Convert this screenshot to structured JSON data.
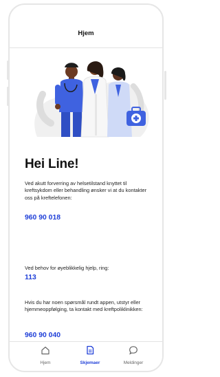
{
  "header": {
    "title": "Hjem"
  },
  "main": {
    "greeting": "Hei Line!",
    "blocks": [
      {
        "text": "Ved akutt forverring av helsetilstand knyttet til kreftsykdom eller behandling ønsker vi at du kontakter oss på kreftelefonen:",
        "phone": "960 90 018"
      },
      {
        "text": "Ved behov for øyeblikkelig hjelp, ring:",
        "phone": "113"
      },
      {
        "text": "Hvis du har noen spørsmål rundt appen, utstyr eller hjemmeoppfølging, ta kontakt med kreftpoliklinikken:",
        "phone": "960 90 040"
      }
    ]
  },
  "tabbar": {
    "items": [
      {
        "label": "Hjem",
        "icon": "home-icon",
        "active": false
      },
      {
        "label": "Skjemaer",
        "icon": "document-icon",
        "active": true
      },
      {
        "label": "Meldinger",
        "icon": "chat-bubble-icon",
        "active": false
      }
    ]
  },
  "colors": {
    "accent": "#1f3fd8",
    "text": "#111111",
    "border": "#e3e3e3"
  }
}
